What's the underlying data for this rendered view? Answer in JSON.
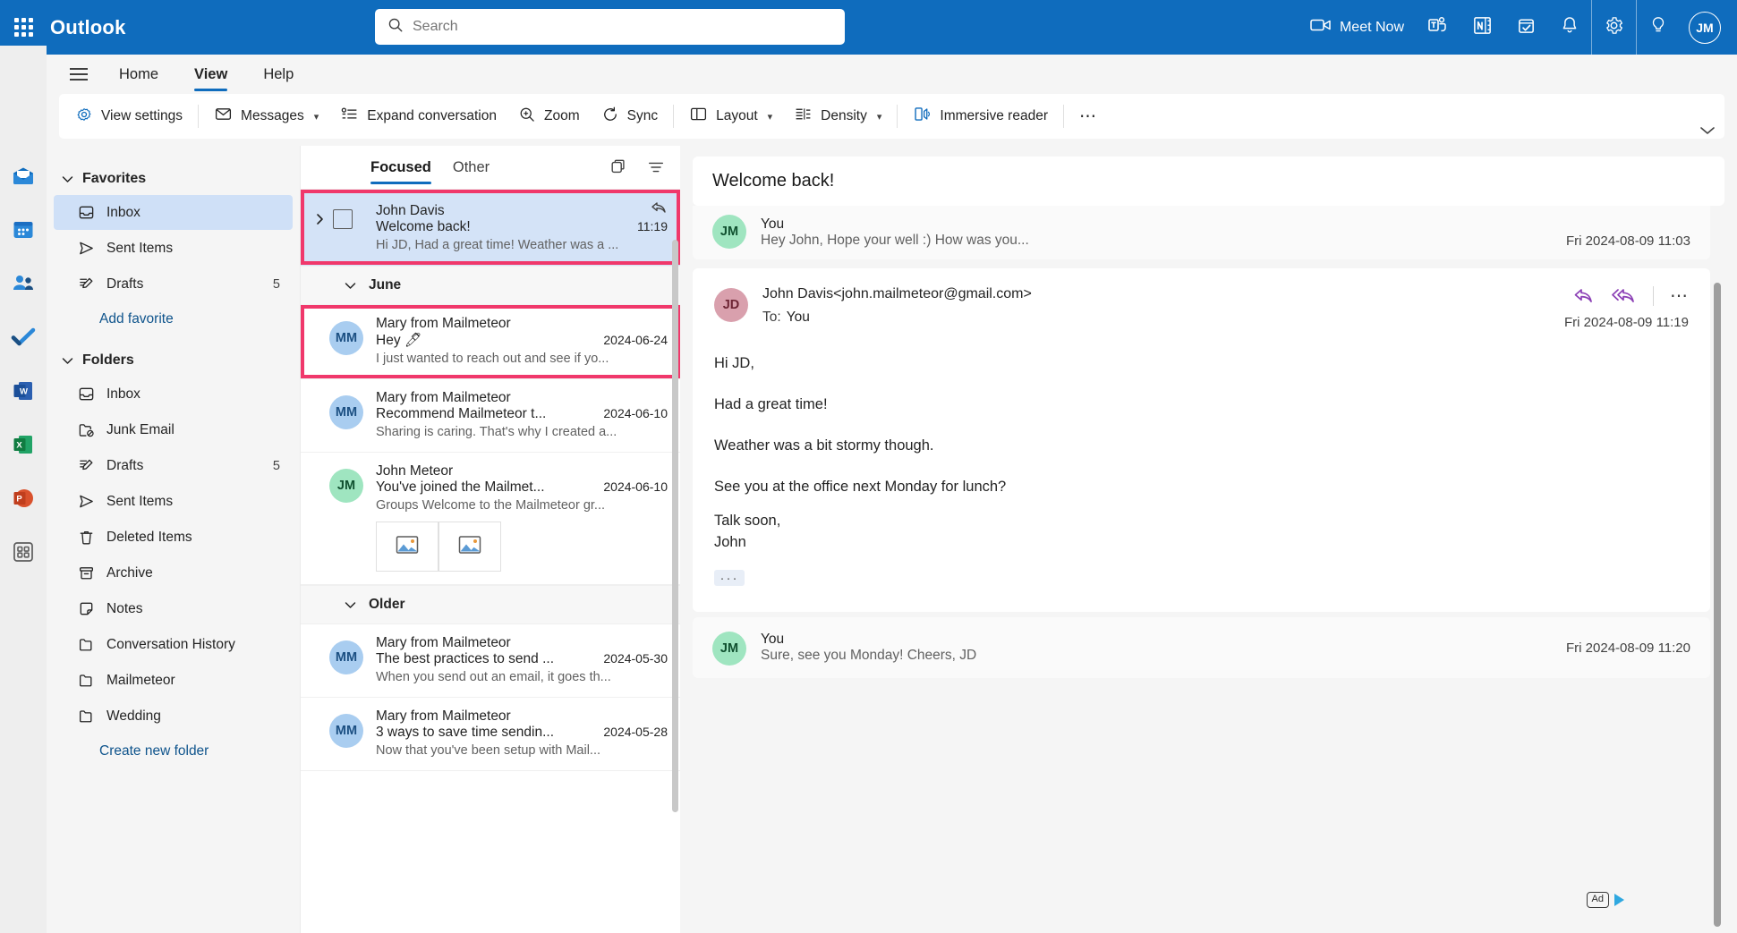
{
  "topbar": {
    "waffle": "app-launcher",
    "brand": "Outlook",
    "search_placeholder": "Search",
    "meet_now": "Meet Now",
    "avatar_initials": "JM"
  },
  "rail": {
    "items": [
      {
        "name": "mail",
        "label": "Mail"
      },
      {
        "name": "calendar",
        "label": "Calendar"
      },
      {
        "name": "people",
        "label": "People"
      },
      {
        "name": "todo",
        "label": "To Do"
      },
      {
        "name": "word",
        "label": "Word"
      },
      {
        "name": "excel",
        "label": "Excel"
      },
      {
        "name": "powerpoint",
        "label": "PowerPoint"
      },
      {
        "name": "apps",
        "label": "More apps"
      }
    ]
  },
  "ribbon": {
    "tabs": [
      {
        "label": "Home",
        "active": false
      },
      {
        "label": "View",
        "active": true
      },
      {
        "label": "Help",
        "active": false
      }
    ],
    "commands": [
      {
        "label": "View settings",
        "icon": "view-settings-icon"
      },
      {
        "label": "Messages",
        "icon": "envelope-icon",
        "caret": true
      },
      {
        "label": "Expand conversation",
        "icon": "expand-conversation-icon"
      },
      {
        "label": "Zoom",
        "icon": "zoom-icon"
      },
      {
        "label": "Sync",
        "icon": "sync-icon"
      },
      {
        "label": "Layout",
        "icon": "layout-icon",
        "caret": true
      },
      {
        "label": "Density",
        "icon": "density-icon",
        "caret": true
      },
      {
        "label": "Immersive reader",
        "icon": "immersive-reader-icon"
      },
      {
        "label": "⋯",
        "icon": "more-options-icon"
      }
    ]
  },
  "sidebar": {
    "favorites": {
      "title": "Favorites",
      "items": [
        {
          "label": "Inbox",
          "icon": "inbox-icon",
          "count": "",
          "selected": true
        },
        {
          "label": "Sent Items",
          "icon": "send-icon",
          "count": "",
          "selected": false
        },
        {
          "label": "Drafts",
          "icon": "drafts-icon",
          "count": "5",
          "selected": false
        }
      ],
      "add_link": "Add favorite"
    },
    "folders": {
      "title": "Folders",
      "items": [
        {
          "label": "Inbox",
          "icon": "inbox-icon",
          "count": ""
        },
        {
          "label": "Junk Email",
          "icon": "junk-icon",
          "count": ""
        },
        {
          "label": "Drafts",
          "icon": "drafts-icon",
          "count": "5"
        },
        {
          "label": "Sent Items",
          "icon": "send-icon",
          "count": ""
        },
        {
          "label": "Deleted Items",
          "icon": "trash-icon",
          "count": ""
        },
        {
          "label": "Archive",
          "icon": "archive-icon",
          "count": ""
        },
        {
          "label": "Notes",
          "icon": "notes-icon",
          "count": ""
        },
        {
          "label": "Conversation History",
          "icon": "folder-icon",
          "count": ""
        },
        {
          "label": "Mailmeteor",
          "icon": "folder-icon",
          "count": ""
        },
        {
          "label": "Wedding",
          "icon": "folder-icon",
          "count": ""
        }
      ],
      "create_link": "Create new folder"
    }
  },
  "list": {
    "tabs": [
      {
        "label": "Focused",
        "active": true
      },
      {
        "label": "Other",
        "active": false
      }
    ],
    "header_icons": [
      "window-switch-icon",
      "filter-icon"
    ],
    "messages": [
      {
        "type": "message",
        "from": "John Davis",
        "subject": "Welcome back!",
        "preview": "Hi JD, Had a great time! Weather was a ...",
        "date": "11:19",
        "selected": true,
        "annotated": true,
        "has_checkbox": true,
        "has_reply_icon": true,
        "avatar": "",
        "avatar_class": ""
      },
      {
        "type": "section",
        "label": "June"
      },
      {
        "type": "message",
        "from": "Mary from Mailmeteor",
        "subject": "Hey 🖊",
        "preview": "I just wanted to reach out and see if yo...",
        "date": "2024-06-24",
        "selected": false,
        "annotated": true,
        "avatar": "MM",
        "avatar_class": "av-blue"
      },
      {
        "type": "message",
        "from": "Mary from Mailmeteor",
        "subject": "Recommend Mailmeteor t...",
        "preview": "Sharing is caring. That's why I created a...",
        "date": "2024-06-10",
        "selected": false,
        "annotated": false,
        "avatar": "MM",
        "avatar_class": "av-blue"
      },
      {
        "type": "message",
        "from": "John Meteor",
        "subject": "You've joined the Mailmet...",
        "preview": "Groups Welcome to the Mailmeteor gr...",
        "date": "2024-06-10",
        "selected": false,
        "annotated": false,
        "avatar": "JM",
        "avatar_class": "av-green",
        "attachments": [
          "image-attachment-icon",
          "image-attachment-icon"
        ]
      },
      {
        "type": "section",
        "label": "Older"
      },
      {
        "type": "message",
        "from": "Mary from Mailmeteor",
        "subject": "The best practices to send ...",
        "preview": "When you send out an email, it goes th...",
        "date": "2024-05-30",
        "selected": false,
        "annotated": false,
        "avatar": "MM",
        "avatar_class": "av-blue"
      },
      {
        "type": "message",
        "from": "Mary from Mailmeteor",
        "subject": "3 ways to save time sendin...",
        "preview": "Now that you've been setup with Mail...",
        "date": "2024-05-28",
        "selected": false,
        "annotated": false,
        "avatar": "MM",
        "avatar_class": "av-blue"
      }
    ]
  },
  "reading": {
    "title": "Welcome back!",
    "collapsed_top": {
      "avatar": "JM",
      "avatar_class": "av-green",
      "name": "You",
      "preview": "Hey John, Hope your well :) How was you...",
      "date": "Fri 2024-08-09 11:03"
    },
    "open_message": {
      "avatar": "JD",
      "avatar_class": "av-rose",
      "from": "John Davis<john.mailmeteor@gmail.com>",
      "to_label": "To:",
      "to_value": "You",
      "date": "Fri 2024-08-09 11:19",
      "actions": [
        "reply-icon",
        "reply-all-icon",
        "more-actions-icon"
      ],
      "body": [
        "Hi JD,",
        "Had a great time!",
        "Weather was a bit stormy though.",
        "See you at the office next Monday for lunch?",
        "Talk soon,"
      ],
      "signature": "John",
      "expand_dots": "···"
    },
    "collapsed_bottom": {
      "avatar": "JM",
      "avatar_class": "av-green",
      "name": "You",
      "preview": "Sure, see you Monday! Cheers, JD",
      "date": "Fri 2024-08-09 11:20"
    },
    "ad_label": "Ad"
  },
  "colors": {
    "accent": "#0f6cbd",
    "annotation": "#f0386b",
    "selection": "#d4e3f7",
    "link": "#0f548c"
  }
}
